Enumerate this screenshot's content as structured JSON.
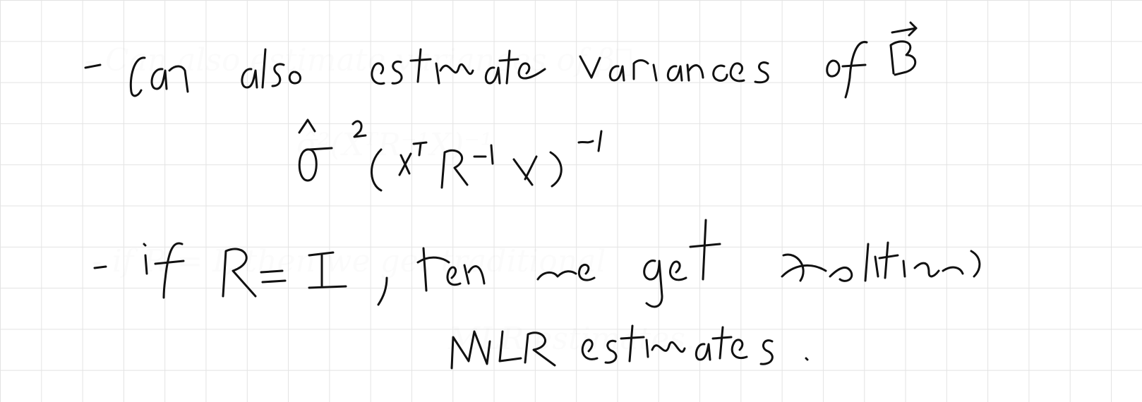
{
  "note": {
    "lines": [
      "- Can also estimate variances of β⃗",
      "σ̂²(XᵀR⁻¹X)⁻¹",
      "- if R = I, then we get traditional",
      "MLR estimates."
    ]
  },
  "colors": {
    "ink": "#111111",
    "grid": "#e3e3e3",
    "paper": "#ffffff"
  }
}
